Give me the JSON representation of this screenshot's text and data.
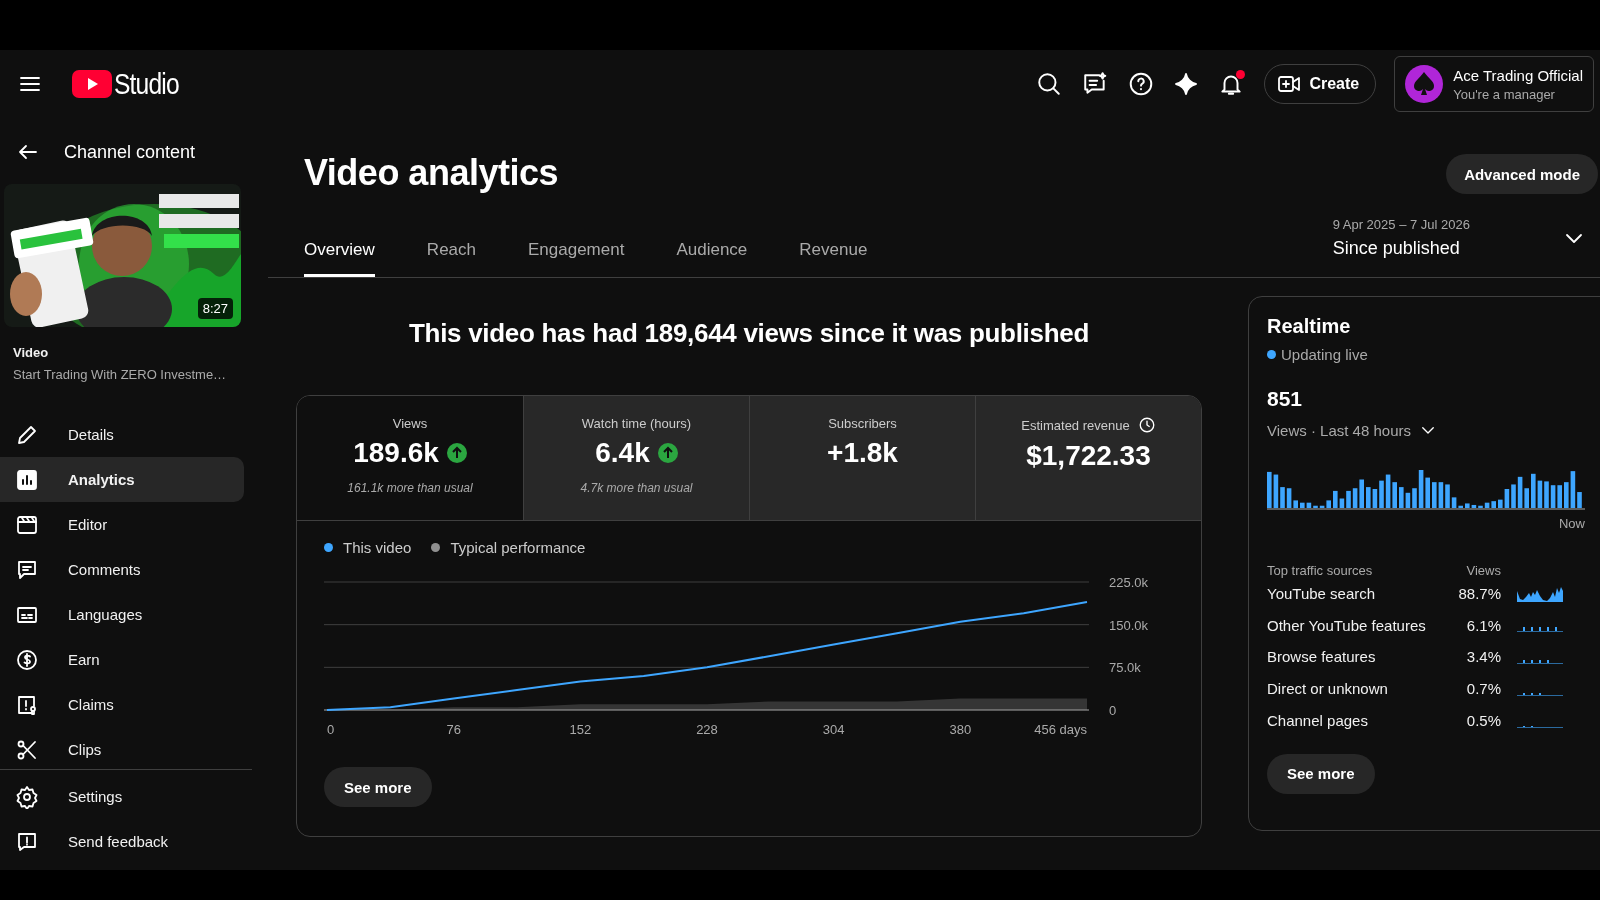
{
  "header": {
    "logo_text": "Studio",
    "create_label": "Create",
    "has_notifications": true,
    "account": {
      "name": "Ace Trading Official",
      "role": "You're a manager"
    }
  },
  "sidebar": {
    "back_label": "Channel content",
    "video": {
      "kind": "picture",
      "duration": "8:27",
      "label": "Video",
      "title": "Start Trading With ZERO Investme…"
    },
    "items": [
      {
        "kind": "details",
        "label": "Details",
        "selected": false
      },
      {
        "kind": "analytics",
        "label": "Analytics",
        "selected": true
      },
      {
        "kind": "editor",
        "label": "Editor",
        "selected": false
      },
      {
        "kind": "comments",
        "label": "Comments",
        "selected": false
      },
      {
        "kind": "languages",
        "label": "Languages",
        "selected": false
      },
      {
        "kind": "earn",
        "label": "Earn",
        "selected": false
      },
      {
        "kind": "claims",
        "label": "Claims",
        "selected": false
      },
      {
        "kind": "clips",
        "label": "Clips",
        "selected": false
      }
    ],
    "footer_items": [
      {
        "kind": "settings",
        "label": "Settings"
      },
      {
        "kind": "feedback",
        "label": "Send feedback"
      }
    ]
  },
  "page": {
    "title": "Video analytics",
    "advanced_button": "Advanced mode",
    "tabs": [
      {
        "label": "Overview",
        "selected": true
      },
      {
        "label": "Reach",
        "selected": false
      },
      {
        "label": "Engagement",
        "selected": false
      },
      {
        "label": "Audience",
        "selected": false
      },
      {
        "label": "Revenue",
        "selected": false
      }
    ],
    "date_range": {
      "range": "9 Apr 2025 – 7 Jul 2026",
      "label": "Since published"
    },
    "headline": "This video has had 189,644 views since it was published",
    "metrics": [
      {
        "label": "Views",
        "value": "189.6k",
        "trending_up": true,
        "note": "161.1k more than usual",
        "has_clock": false,
        "selected": true
      },
      {
        "label": "Watch time (hours)",
        "value": "6.4k",
        "trending_up": true,
        "note": "4.7k more than usual",
        "has_clock": false,
        "selected": false
      },
      {
        "label": "Subscribers",
        "value": "+1.8k",
        "trending_up": false,
        "has_clock": false,
        "selected": false
      },
      {
        "label": "Estimated revenue",
        "value": "$1,722.33",
        "trending_up": false,
        "has_clock": true,
        "selected": false
      }
    ],
    "chart_data": {
      "type": "line",
      "x": [
        0,
        38,
        76,
        114,
        152,
        190,
        228,
        266,
        304,
        342,
        380,
        418,
        456
      ],
      "series": [
        {
          "name": "This video",
          "type": "line",
          "color": "#3ea6ff",
          "values": [
            0,
            5000,
            20000,
            35000,
            50000,
            60000,
            75000,
            95000,
            115000,
            135000,
            155000,
            170000,
            190000
          ]
        },
        {
          "name": "Typical performance",
          "type": "area",
          "color": "#909090",
          "values": [
            0,
            0,
            5000,
            5000,
            10000,
            10000,
            10000,
            15000,
            15000,
            15000,
            20000,
            20000,
            20000
          ]
        }
      ],
      "xlim": [
        0,
        456
      ],
      "ylim": [
        0,
        225000
      ],
      "xticks": [
        0,
        76,
        152,
        228,
        304,
        380,
        {
          "value": 456,
          "label": "456 days"
        }
      ],
      "yticks": [
        0,
        {
          "value": 75000,
          "label": "75.0k"
        },
        {
          "value": 150000,
          "label": "150.0k"
        },
        {
          "value": 225000,
          "label": "225.0k"
        }
      ]
    },
    "see_more": "See more"
  },
  "realtime": {
    "title": "Realtime",
    "status": "Updating live",
    "count": "851",
    "period": "Views · Last 48 hours",
    "now_label": "Now",
    "sources_heading": "Top traffic sources",
    "views_heading": "Views",
    "sources": [
      {
        "name": "YouTube search",
        "share": "88.7%"
      },
      {
        "name": "Other YouTube features",
        "share": "6.1%"
      },
      {
        "name": "Browse features",
        "share": "3.4%"
      },
      {
        "name": "Direct or unknown",
        "share": "0.7%"
      },
      {
        "name": "Channel pages",
        "share": "0.5%"
      }
    ],
    "see_more": "See more"
  }
}
